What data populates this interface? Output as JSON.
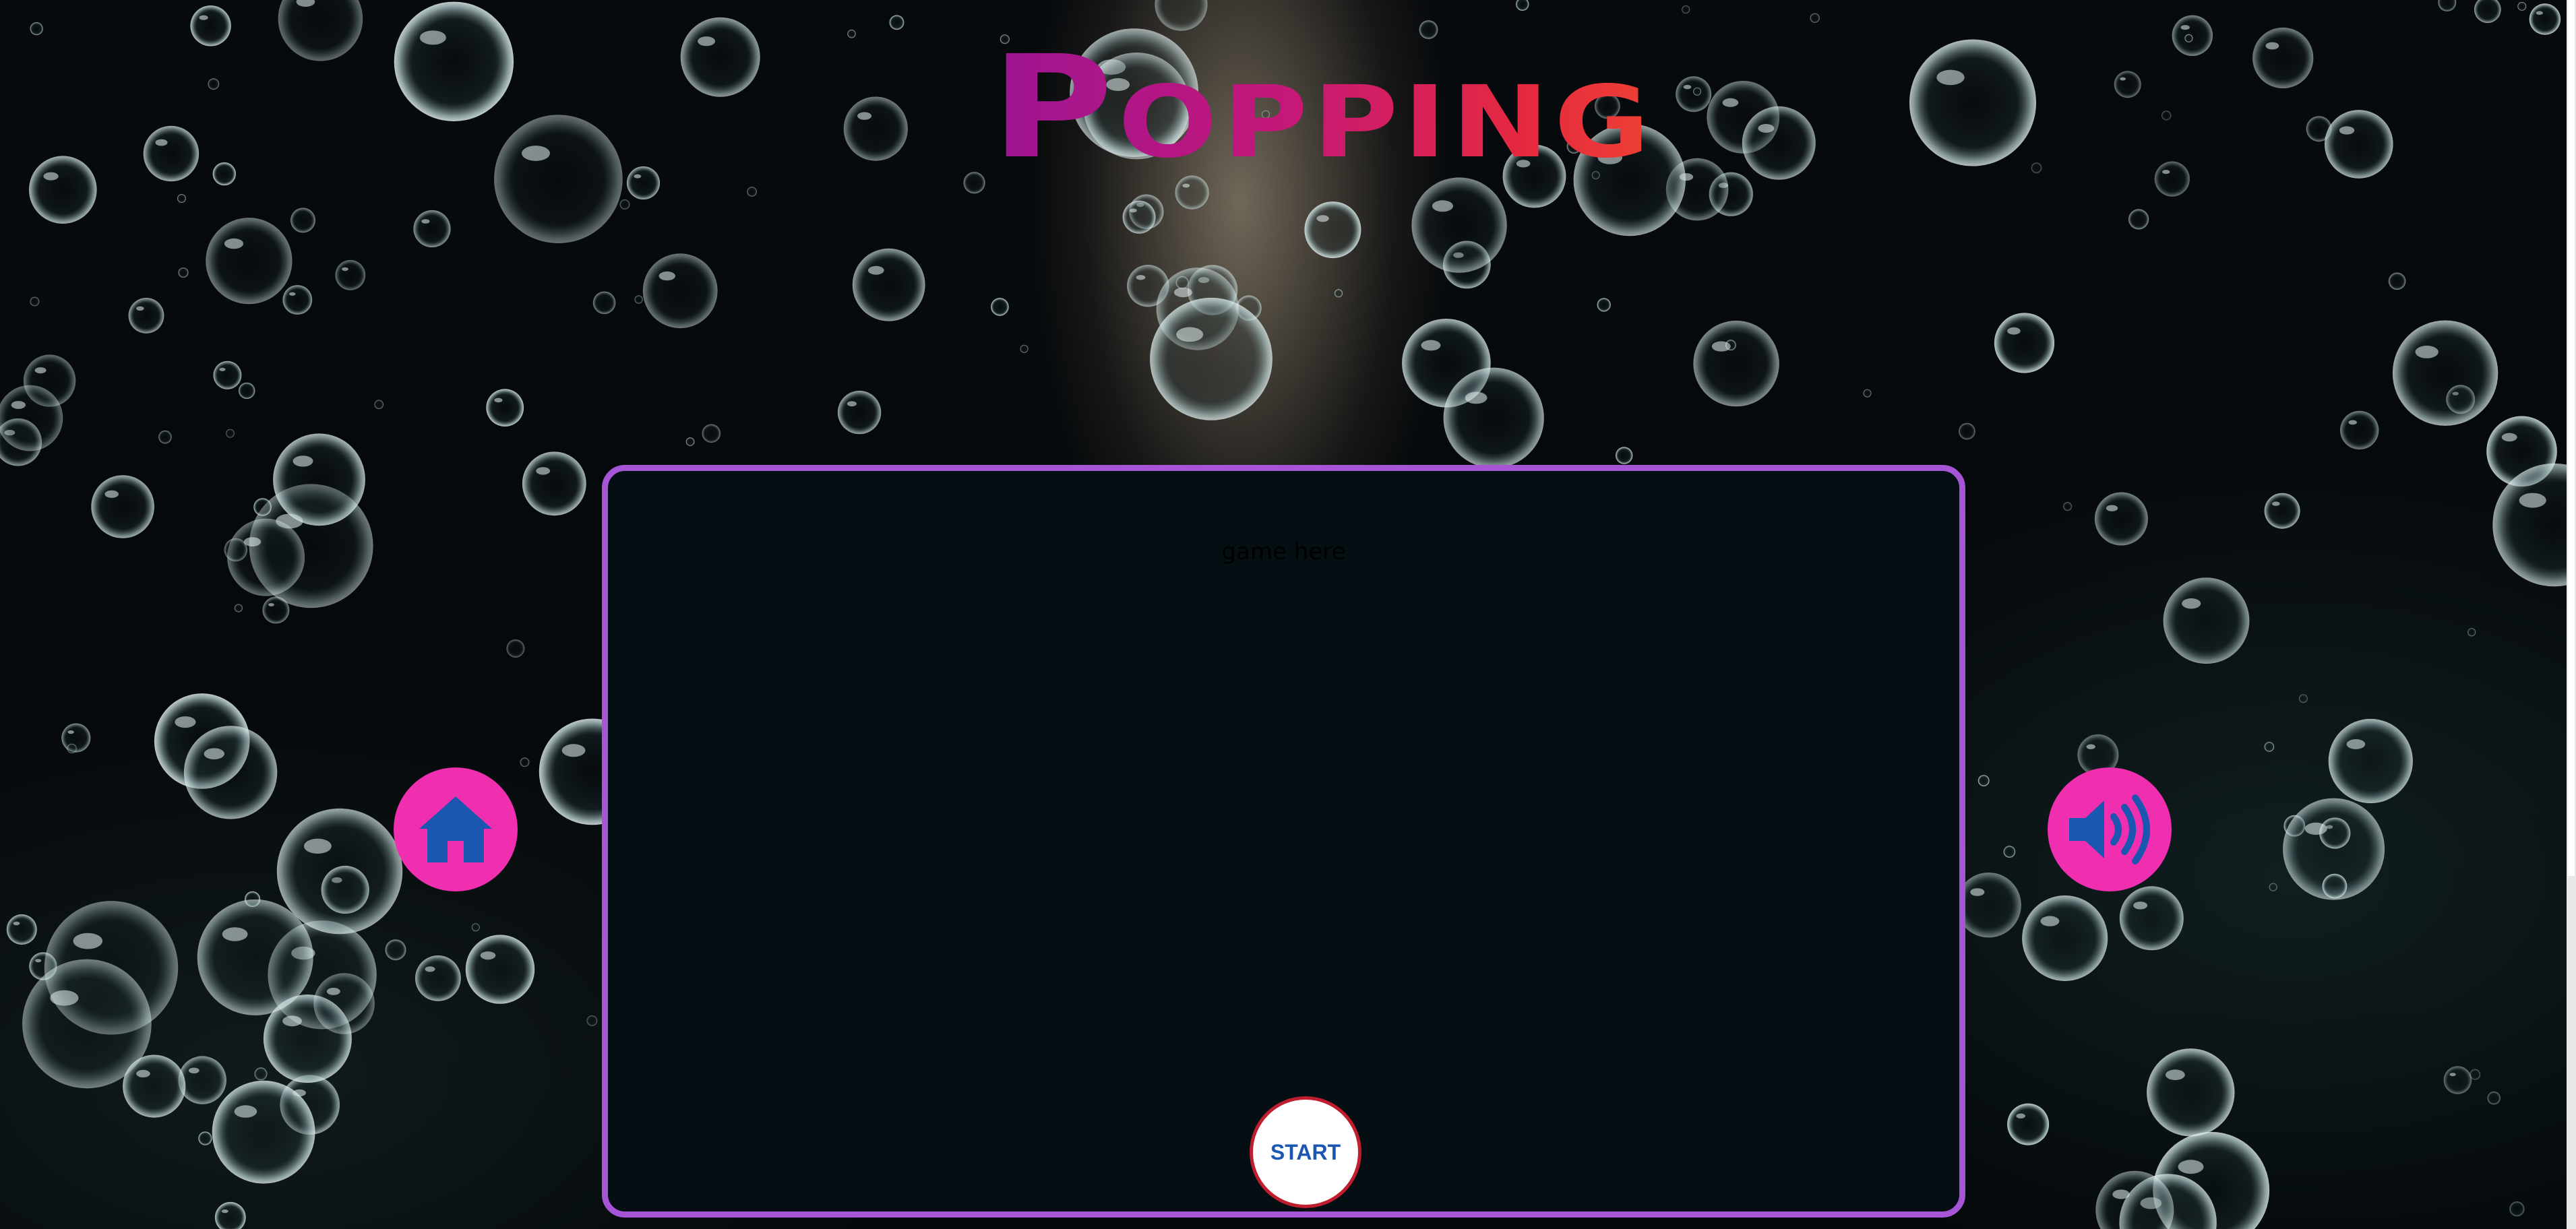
{
  "game": {
    "title": "Popping",
    "placeholder": "game here",
    "start_label": "START"
  },
  "icons": {
    "home": "home-icon",
    "sound": "volume-icon"
  },
  "colors": {
    "frame_border": "#a655d6",
    "round_button": "#f02fb0",
    "icon_blue": "#1b56b0",
    "start_border": "#c01e2e",
    "title_gradient": [
      "#9c1592",
      "#e6293f"
    ]
  }
}
